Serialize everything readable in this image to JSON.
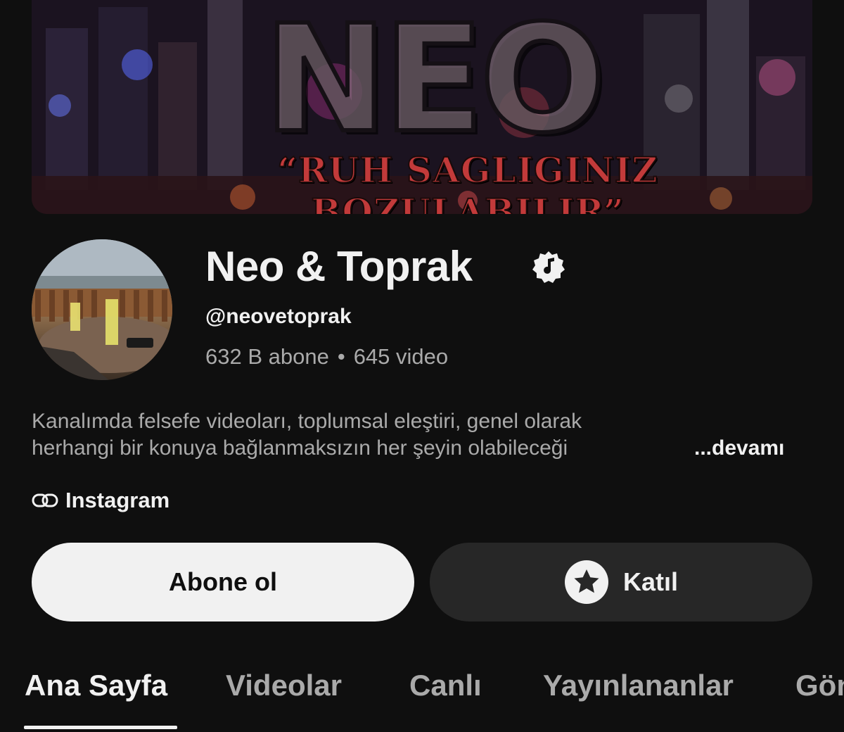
{
  "banner": {
    "logo_text": "NEO",
    "tagline": "“RUH SAGLIGINIZ BOZULABILIR”"
  },
  "channel": {
    "name": "Neo & Toprak",
    "verified_icon": "music-note-verified-icon",
    "handle": "@neovetoprak",
    "subscribers": "632 B abone",
    "separator": "•",
    "videos": "645 video"
  },
  "description": {
    "line1": "Kanalımda felsefe videoları, toplumsal eleştiri, genel olarak",
    "line2": "herhangi bir konuya bağlanmaksızın her şeyin olabileceği",
    "more_label": "...devamı"
  },
  "link": {
    "icon": "link-icon",
    "label": "Instagram"
  },
  "buttons": {
    "subscribe_label": "Abone ol",
    "join_label": "Katıl",
    "join_icon": "star-icon"
  },
  "tabs": [
    {
      "label": "Ana Sayfa",
      "active": true
    },
    {
      "label": "Videolar",
      "active": false
    },
    {
      "label": "Canlı",
      "active": false
    },
    {
      "label": "Yayınlananlar",
      "active": false
    },
    {
      "label": "Gönderiler",
      "active": false
    }
  ],
  "colors": {
    "background": "#0f0f0f",
    "text_primary": "#f1f1f1",
    "text_secondary": "#aaaaaa",
    "subscribe_bg": "#f1f1f1",
    "join_bg": "#272727",
    "tagline_red": "#c23a3a"
  }
}
